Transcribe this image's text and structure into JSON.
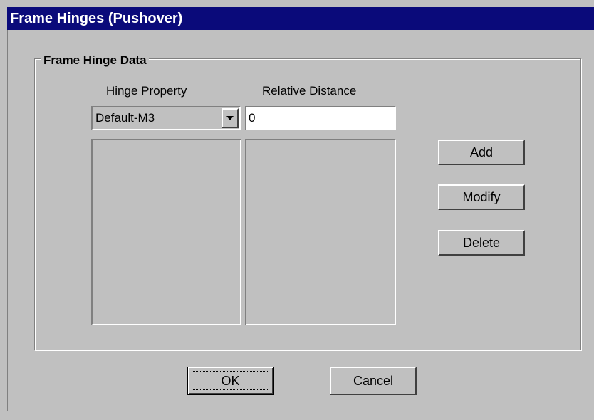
{
  "window": {
    "title": "Frame Hinges (Pushover)"
  },
  "group": {
    "legend": "Frame Hinge Data",
    "columns": {
      "hinge_property": "Hinge Property",
      "relative_distance": "Relative Distance"
    },
    "hinge_property_select": {
      "selected": "Default-M3"
    },
    "relative_distance_input": {
      "value": "0"
    },
    "hinge_list": [],
    "distance_list": []
  },
  "side_buttons": {
    "add": "Add",
    "modify": "Modify",
    "delete": "Delete"
  },
  "footer_buttons": {
    "ok": "OK",
    "cancel": "Cancel"
  },
  "colors": {
    "title_bar": "#0a0a7a",
    "face": "#c0c0c0"
  }
}
